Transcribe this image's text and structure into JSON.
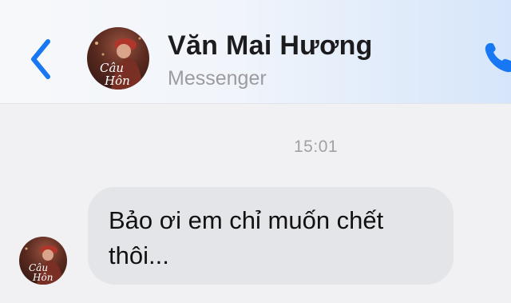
{
  "header": {
    "contact_name": "Văn Mai Hương",
    "subtitle": "Messenger",
    "avatar_caption_line1": "Câu",
    "avatar_caption_line2": "Hôn",
    "accent_color": "#1877f2",
    "back_icon": "chevron-left-icon",
    "call_icon": "phone-icon"
  },
  "thread": {
    "timestamp": "15:01",
    "messages": [
      {
        "text": "Bảo ơi em chỉ muốn chết thôi..."
      }
    ]
  }
}
